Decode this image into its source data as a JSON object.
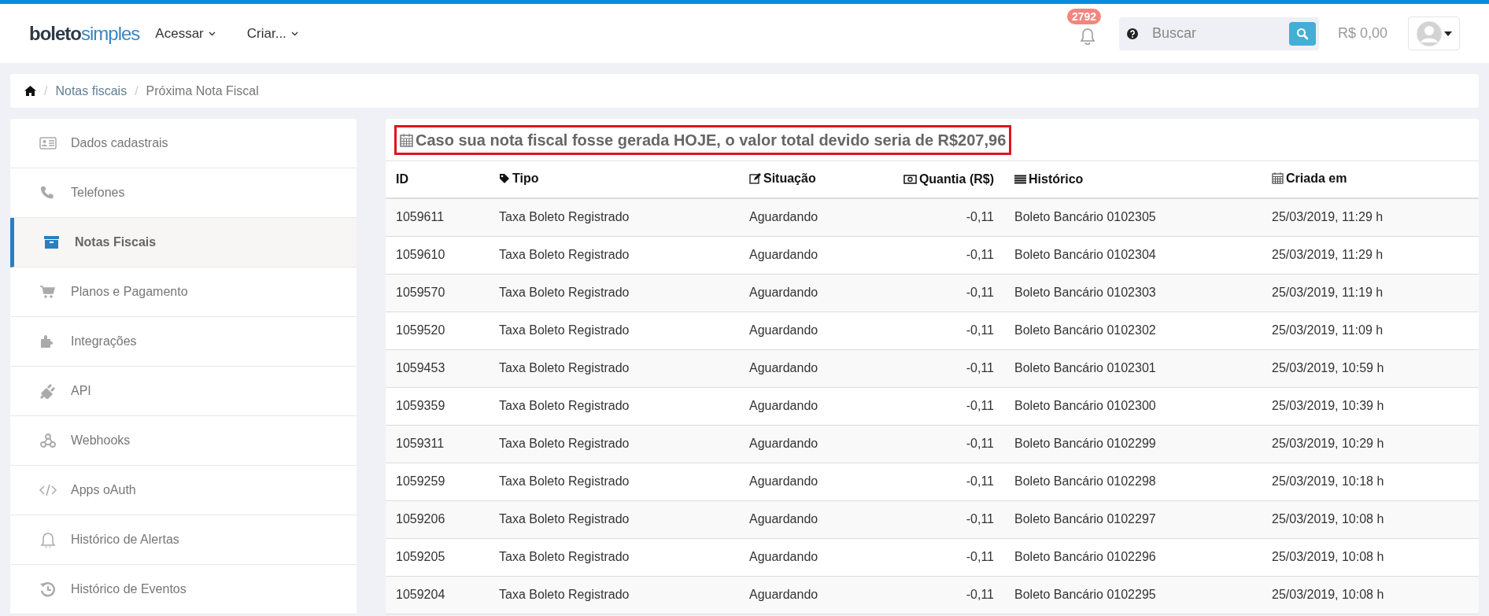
{
  "header": {
    "logo": {
      "part_1": "boleto",
      "part_2": "simples"
    },
    "menus": [
      {
        "label": "Acessar"
      },
      {
        "label": "Criar..."
      }
    ],
    "notifications": {
      "count": "2792"
    },
    "search": {
      "placeholder": "Buscar"
    },
    "balance": "R$ 0,00"
  },
  "breadcrumb": {
    "separator": "/",
    "items": [
      {
        "label": "Notas fiscais",
        "link": true
      },
      {
        "label": "Próxima Nota Fiscal",
        "link": false
      }
    ]
  },
  "sidebar": {
    "items": [
      {
        "label": "Dados cadastrais",
        "selected": false
      },
      {
        "label": "Telefones",
        "selected": false
      },
      {
        "label": "Notas Fiscais",
        "selected": true
      },
      {
        "label": "Planos e Pagamento",
        "selected": false
      },
      {
        "label": "Integrações",
        "selected": false
      },
      {
        "label": "API",
        "selected": false
      },
      {
        "label": "Webhooks",
        "selected": false
      },
      {
        "label": "Apps oAuth",
        "selected": false
      },
      {
        "label": "Histórico de Alertas",
        "selected": false
      },
      {
        "label": "Histórico de Eventos",
        "selected": false
      }
    ]
  },
  "notice": "Caso sua nota fiscal fosse gerada HOJE, o valor total devido seria de R$207,96",
  "table": {
    "columns": [
      "ID",
      "Tipo",
      "Situação",
      "Quantia (R$)",
      "Histórico",
      "Criada em"
    ],
    "rows": [
      [
        "1059611",
        "Taxa Boleto Registrado",
        "Aguardando",
        "-0,11",
        "Boleto Bancário 0102305",
        "25/03/2019, 11:29 h"
      ],
      [
        "1059610",
        "Taxa Boleto Registrado",
        "Aguardando",
        "-0,11",
        "Boleto Bancário 0102304",
        "25/03/2019, 11:29 h"
      ],
      [
        "1059570",
        "Taxa Boleto Registrado",
        "Aguardando",
        "-0,11",
        "Boleto Bancário 0102303",
        "25/03/2019, 11:19 h"
      ],
      [
        "1059520",
        "Taxa Boleto Registrado",
        "Aguardando",
        "-0,11",
        "Boleto Bancário 0102302",
        "25/03/2019, 11:09 h"
      ],
      [
        "1059453",
        "Taxa Boleto Registrado",
        "Aguardando",
        "-0,11",
        "Boleto Bancário 0102301",
        "25/03/2019, 10:59 h"
      ],
      [
        "1059359",
        "Taxa Boleto Registrado",
        "Aguardando",
        "-0,11",
        "Boleto Bancário 0102300",
        "25/03/2019, 10:39 h"
      ],
      [
        "1059311",
        "Taxa Boleto Registrado",
        "Aguardando",
        "-0,11",
        "Boleto Bancário 0102299",
        "25/03/2019, 10:29 h"
      ],
      [
        "1059259",
        "Taxa Boleto Registrado",
        "Aguardando",
        "-0,11",
        "Boleto Bancário 0102298",
        "25/03/2019, 10:18 h"
      ],
      [
        "1059206",
        "Taxa Boleto Registrado",
        "Aguardando",
        "-0,11",
        "Boleto Bancário 0102297",
        "25/03/2019, 10:08 h"
      ],
      [
        "1059205",
        "Taxa Boleto Registrado",
        "Aguardando",
        "-0,11",
        "Boleto Bancário 0102296",
        "25/03/2019, 10:08 h"
      ],
      [
        "1059204",
        "Taxa Boleto Registrado",
        "Aguardando",
        "-0,11",
        "Boleto Bancário 0102295",
        "25/03/2019, 10:08 h"
      ]
    ]
  }
}
